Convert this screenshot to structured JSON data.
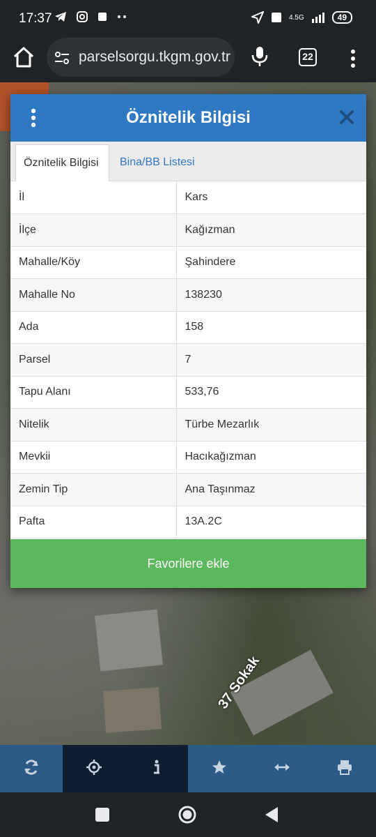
{
  "status_bar": {
    "time": "17:37",
    "network": "4.5G",
    "battery": "49"
  },
  "browser": {
    "url": "parselsorgu.tkgm.gov.tr",
    "tab_count": "22"
  },
  "map": {
    "street_label": "37 Sokak"
  },
  "dialog": {
    "title": "Öznitelik Bilgisi",
    "tabs": [
      {
        "label": "Öznitelik Bilgisi"
      },
      {
        "label": "Bina/BB Listesi"
      }
    ],
    "rows": [
      {
        "key": "İl",
        "value": "Kars"
      },
      {
        "key": "İlçe",
        "value": "Kağızman"
      },
      {
        "key": "Mahalle/Köy",
        "value": "Şahindere"
      },
      {
        "key": "Mahalle No",
        "value": "138230"
      },
      {
        "key": "Ada",
        "value": "158"
      },
      {
        "key": "Parsel",
        "value": "7"
      },
      {
        "key": "Tapu Alanı",
        "value": "533,76"
      },
      {
        "key": "Nitelik",
        "value": "Türbe Mezarlık"
      },
      {
        "key": "Mevkii",
        "value": "Hacıkağızman"
      },
      {
        "key": "Zemin Tip",
        "value": "Ana Taşınmaz"
      },
      {
        "key": "Pafta",
        "value": "13A.2C"
      }
    ],
    "favorite_button": "Favorilere ekle"
  },
  "toolbar": {
    "items": [
      "refresh-icon",
      "locate-icon",
      "info-icon",
      "star-icon",
      "measure-icon",
      "print-icon"
    ]
  },
  "colors": {
    "header_blue": "#2f78c2",
    "button_green": "#5cb85c",
    "toolbar_blue": "#2b5a87",
    "toolbar_active": "#0c1e30"
  }
}
